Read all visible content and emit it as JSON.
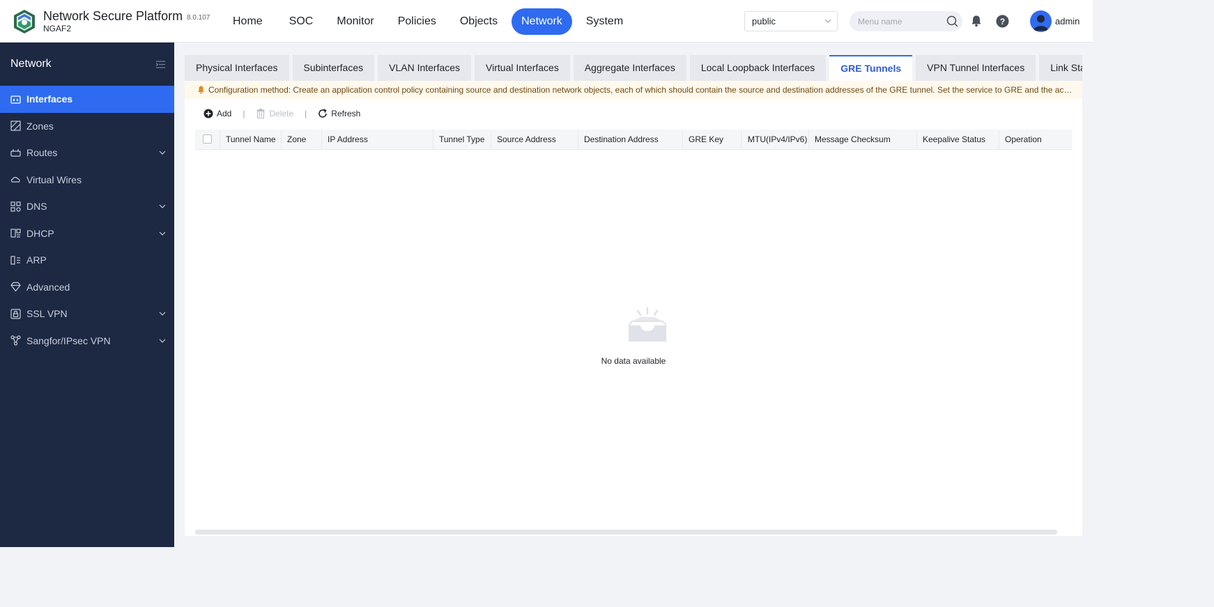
{
  "header": {
    "brand_title": "Network Secure Platform",
    "brand_subtitle": "NGAF2",
    "version": "8.0.107",
    "nav": [
      {
        "label": "Home",
        "active": false
      },
      {
        "label": "SOC",
        "active": false
      },
      {
        "label": "Monitor",
        "active": false
      },
      {
        "label": "Policies",
        "active": false
      },
      {
        "label": "Objects",
        "active": false
      },
      {
        "label": "Network",
        "active": true
      },
      {
        "label": "System",
        "active": false
      }
    ],
    "tenant_select": "public",
    "search_placeholder": "Menu name",
    "user": "admin"
  },
  "sidebar": {
    "title": "Network",
    "items": [
      {
        "label": "Interfaces",
        "icon": "interfaces-icon",
        "active": true,
        "expandable": false
      },
      {
        "label": "Zones",
        "icon": "zones-icon",
        "active": false,
        "expandable": false
      },
      {
        "label": "Routes",
        "icon": "routes-icon",
        "active": false,
        "expandable": true
      },
      {
        "label": "Virtual Wires",
        "icon": "virtual-wires-icon",
        "active": false,
        "expandable": false
      },
      {
        "label": "DNS",
        "icon": "dns-icon",
        "active": false,
        "expandable": true
      },
      {
        "label": "DHCP",
        "icon": "dhcp-icon",
        "active": false,
        "expandable": true
      },
      {
        "label": "ARP",
        "icon": "arp-icon",
        "active": false,
        "expandable": false
      },
      {
        "label": "Advanced",
        "icon": "advanced-icon",
        "active": false,
        "expandable": false
      },
      {
        "label": "SSL VPN",
        "icon": "ssl-vpn-icon",
        "active": false,
        "expandable": true
      },
      {
        "label": "Sangfor/IPsec VPN",
        "icon": "ipsec-vpn-icon",
        "active": false,
        "expandable": true
      }
    ]
  },
  "tabs": [
    {
      "label": "Physical Interfaces",
      "active": false
    },
    {
      "label": "Subinterfaces",
      "active": false
    },
    {
      "label": "VLAN Interfaces",
      "active": false
    },
    {
      "label": "Virtual Interfaces",
      "active": false
    },
    {
      "label": "Aggregate Interfaces",
      "active": false
    },
    {
      "label": "Local Loopback Interfaces",
      "active": false
    },
    {
      "label": "GRE Tunnels",
      "active": true
    },
    {
      "label": "VPN Tunnel Interfaces",
      "active": false
    },
    {
      "label": "Link State Propa",
      "active": false
    }
  ],
  "notice": "Configuration method: Create an application control policy containing source and destination network objects, each of which should contain the source and destination addresses of the GRE tunnel. Set the service to GRE and the action to ...",
  "toolbar": {
    "add": "Add",
    "delete": "Delete",
    "refresh": "Refresh",
    "separator": "|"
  },
  "table": {
    "columns": [
      {
        "label": "Tunnel Name"
      },
      {
        "label": "Zone"
      },
      {
        "label": "IP Address"
      },
      {
        "label": "Tunnel Type"
      },
      {
        "label": "Source Address"
      },
      {
        "label": "Destination Address"
      },
      {
        "label": "GRE Key"
      },
      {
        "label": "MTU(IPv4/IPv6)"
      },
      {
        "label": "Message Checksum"
      },
      {
        "label": "Keepalive Status"
      },
      {
        "label": "Operation"
      }
    ],
    "rows": [],
    "empty_text": "No data available"
  },
  "colors": {
    "accent": "#2f6bf0",
    "sidebar_bg": "#1d2843",
    "notice_bg": "#fff8ec"
  }
}
